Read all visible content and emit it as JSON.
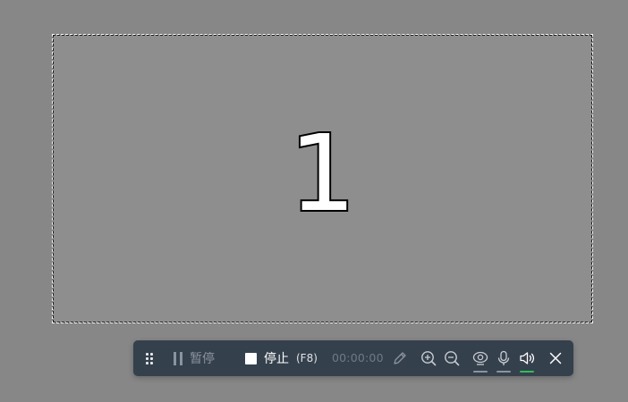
{
  "countdown": {
    "value": "1"
  },
  "toolbar": {
    "pause_label": "暂停",
    "stop_label": "停止",
    "stop_shortcut": "(F8)",
    "timer": "00:00:00",
    "icons": {
      "drag_handle": "drag-handle-icon",
      "pause": "pause-icon",
      "stop": "stop-icon",
      "pen": "pen-icon",
      "zoom_in": "zoom-in-icon",
      "zoom_out": "zoom-out-icon",
      "webcam": "webcam-icon",
      "microphone": "microphone-icon",
      "speaker": "speaker-icon",
      "close": "close-icon"
    }
  },
  "colors": {
    "background": "#878787",
    "region_fill": "#8e8e8e",
    "toolbar_bg": "#35404d",
    "disabled_text": "#8a949f",
    "active_text": "#ffffff",
    "webcam_status": "#8a949f",
    "mic_status": "#8a949f",
    "speaker_status": "#2fbf5a"
  }
}
